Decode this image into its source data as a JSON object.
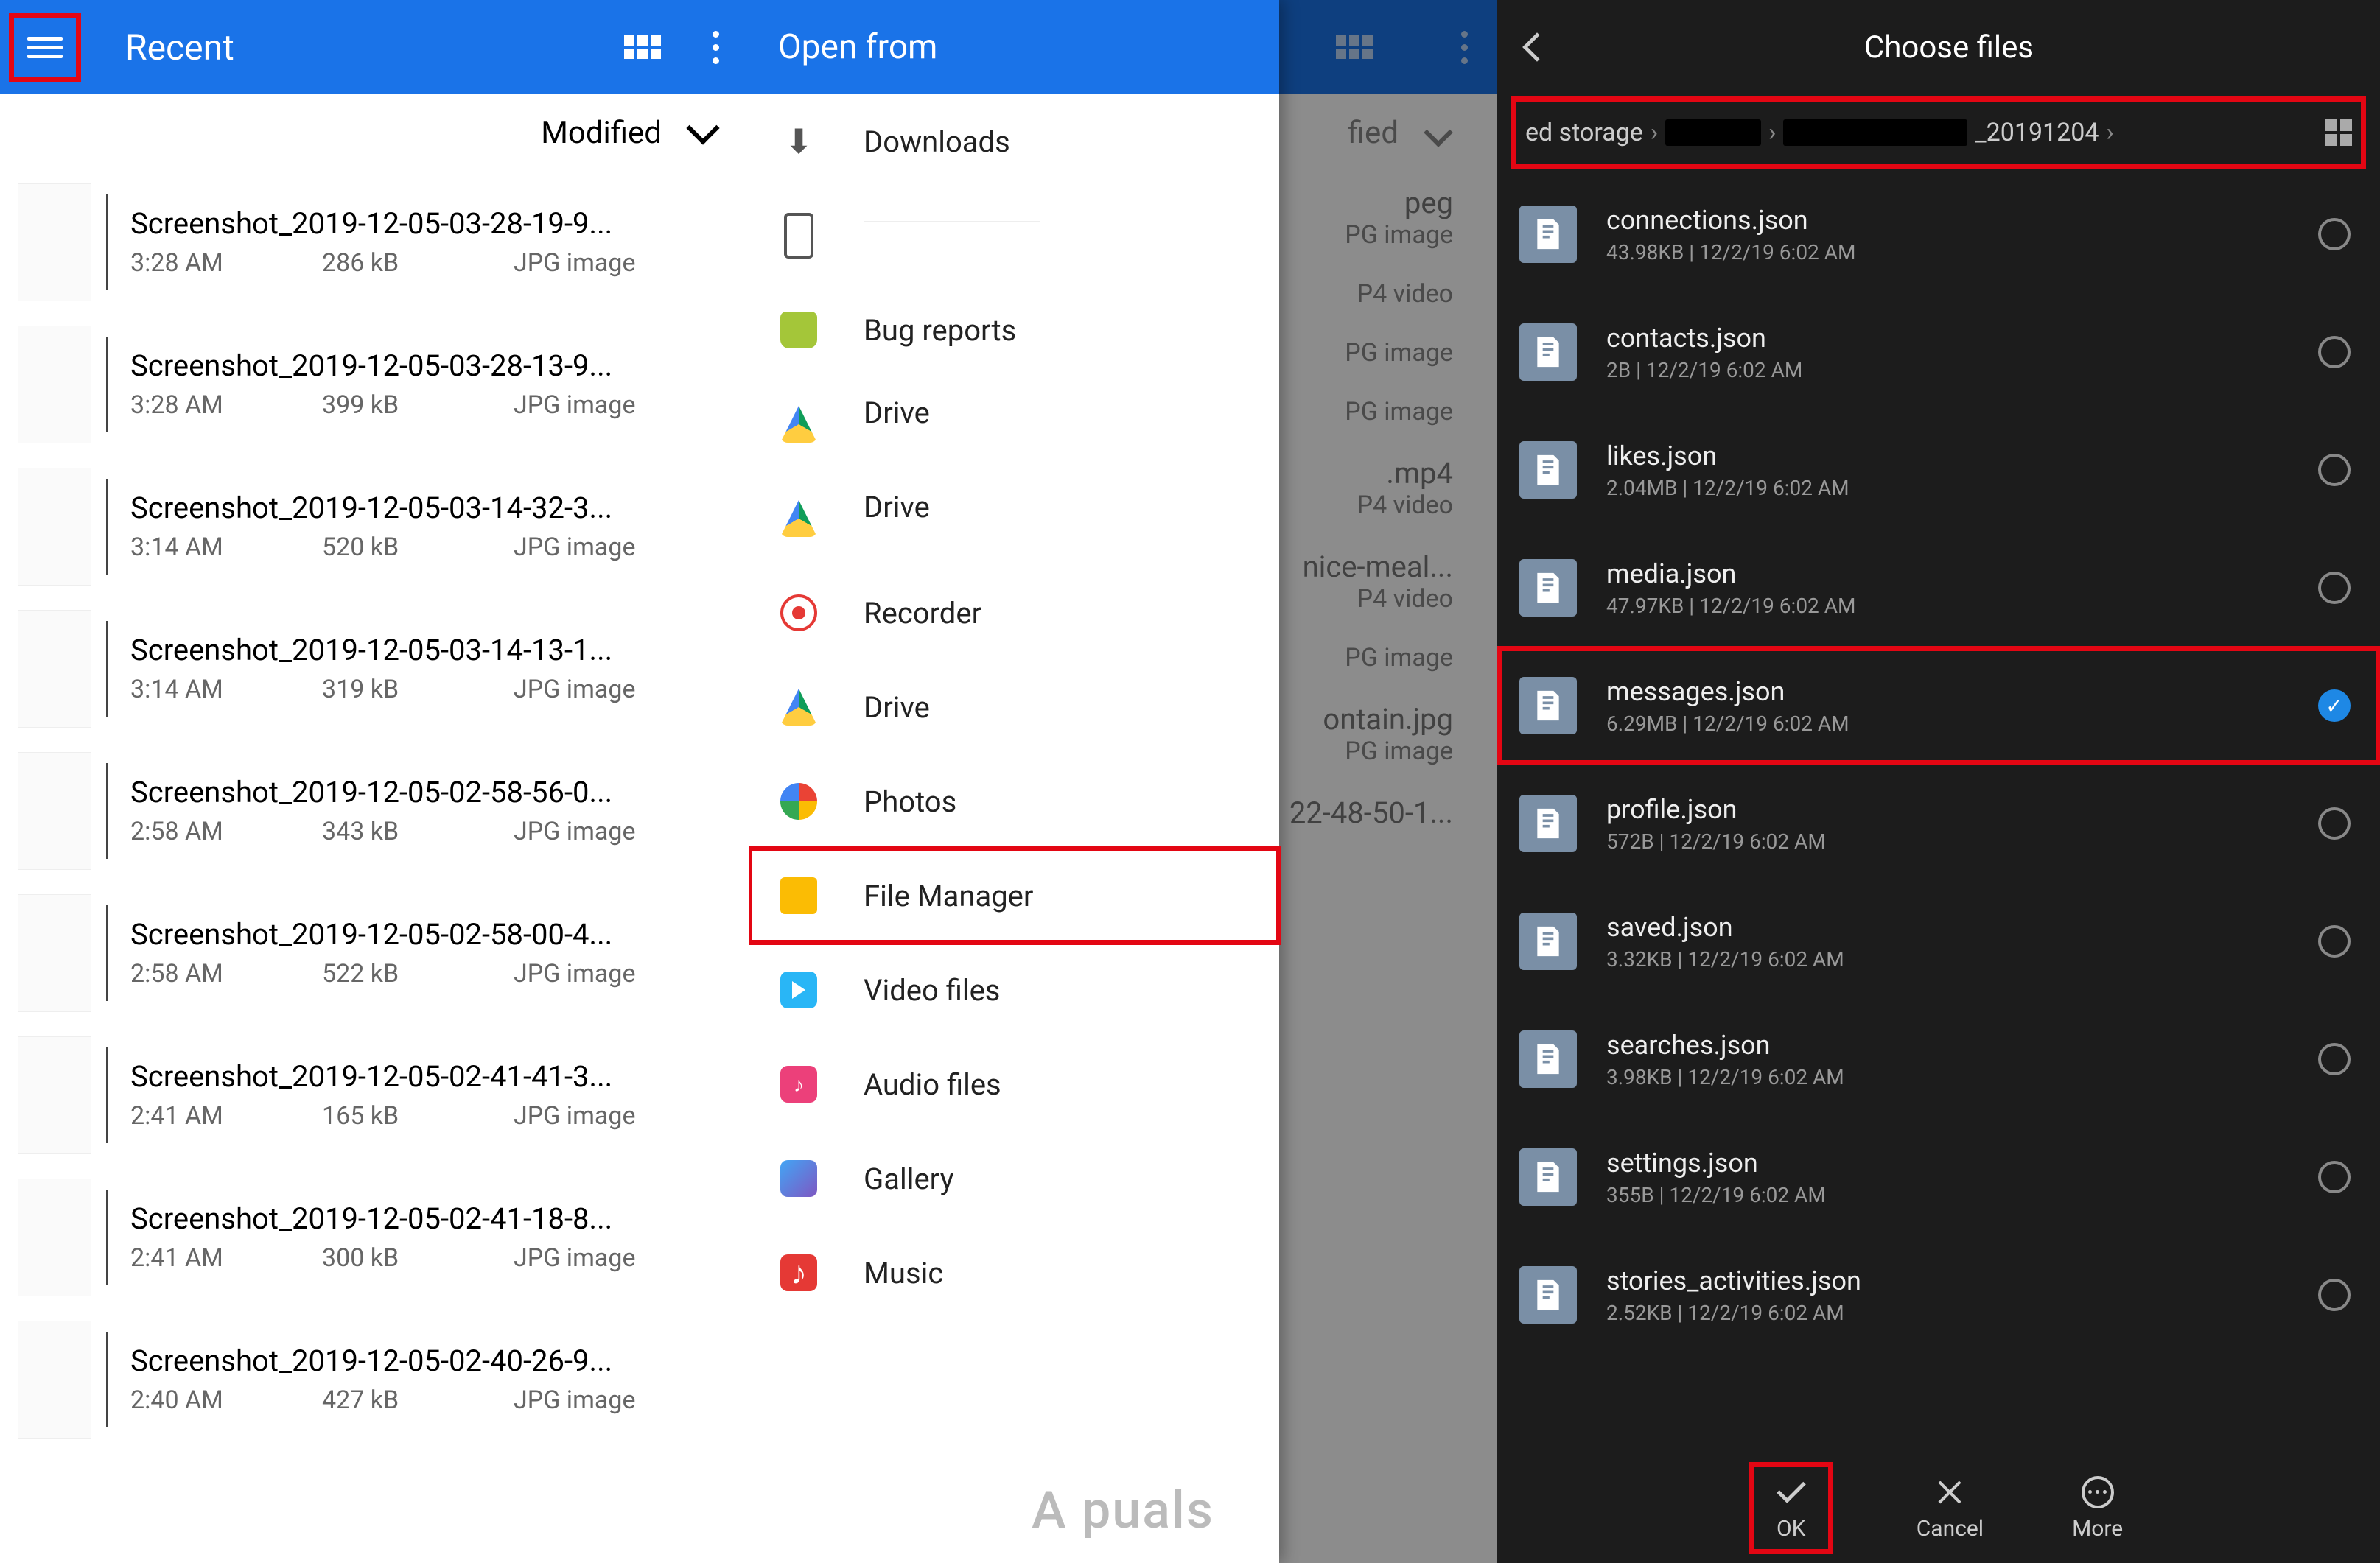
{
  "pane1": {
    "title": "Recent",
    "sort_label": "Modified",
    "files": [
      {
        "name": "Screenshot_2019-12-05-03-28-19-9...",
        "time": "3:28 AM",
        "size": "286 kB",
        "type": "JPG image"
      },
      {
        "name": "Screenshot_2019-12-05-03-28-13-9...",
        "time": "3:28 AM",
        "size": "399 kB",
        "type": "JPG image"
      },
      {
        "name": "Screenshot_2019-12-05-03-14-32-3...",
        "time": "3:14 AM",
        "size": "520 kB",
        "type": "JPG image"
      },
      {
        "name": "Screenshot_2019-12-05-03-14-13-1...",
        "time": "3:14 AM",
        "size": "319 kB",
        "type": "JPG image"
      },
      {
        "name": "Screenshot_2019-12-05-02-58-56-0...",
        "time": "2:58 AM",
        "size": "343 kB",
        "type": "JPG image"
      },
      {
        "name": "Screenshot_2019-12-05-02-58-00-4...",
        "time": "2:58 AM",
        "size": "522 kB",
        "type": "JPG image"
      },
      {
        "name": "Screenshot_2019-12-05-02-41-41-3...",
        "time": "2:41 AM",
        "size": "165 kB",
        "type": "JPG image"
      },
      {
        "name": "Screenshot_2019-12-05-02-41-18-8...",
        "time": "2:41 AM",
        "size": "300 kB",
        "type": "JPG image"
      },
      {
        "name": "Screenshot_2019-12-05-02-40-26-9...",
        "time": "2:40 AM",
        "size": "427 kB",
        "type": "JPG image"
      }
    ]
  },
  "pane2": {
    "drawer_title": "Open from",
    "dim_sort": "fied",
    "items": [
      {
        "label": "Downloads",
        "icon": "dl"
      },
      {
        "label": "",
        "icon": "phone",
        "redacted": true
      },
      {
        "label": "Bug reports",
        "icon": "android"
      },
      {
        "label": "Drive",
        "icon": "drive",
        "sub_redacted": true
      },
      {
        "label": "Drive",
        "icon": "drive",
        "sub_redacted": true
      },
      {
        "label": "Recorder",
        "icon": "rec"
      },
      {
        "label": "Drive",
        "icon": "drive"
      },
      {
        "label": "Photos",
        "icon": "photos"
      },
      {
        "label": "File Manager",
        "icon": "folder",
        "highlight": true
      },
      {
        "label": "Video files",
        "icon": "vid"
      },
      {
        "label": "Audio files",
        "icon": "aud"
      },
      {
        "label": "Gallery",
        "icon": "gal"
      },
      {
        "label": "Music",
        "icon": "mus"
      }
    ],
    "dim_files": [
      {
        "name": "peg",
        "type": "PG image"
      },
      {
        "name": "",
        "type": "P4 video"
      },
      {
        "name": "",
        "type": "PG image"
      },
      {
        "name": "",
        "type": "PG image"
      },
      {
        "name": ".mp4",
        "type": "P4 video"
      },
      {
        "name": "nice-meal...",
        "type": "P4 video"
      },
      {
        "name": "",
        "type": "PG image"
      },
      {
        "name": "ontain.jpg",
        "type": "PG image"
      },
      {
        "name": "22-48-50-1...",
        "type": ""
      }
    ]
  },
  "pane3": {
    "title": "Choose files",
    "crumb_prefix": "ed storage",
    "crumb_suffix": "_20191204",
    "files": [
      {
        "name": "connections.json",
        "meta": "43.98KB | 12/2/19 6:02 AM",
        "selected": false
      },
      {
        "name": "contacts.json",
        "meta": "2B | 12/2/19 6:02 AM",
        "selected": false
      },
      {
        "name": "likes.json",
        "meta": "2.04MB | 12/2/19 6:02 AM",
        "selected": false
      },
      {
        "name": "media.json",
        "meta": "47.97KB | 12/2/19 6:02 AM",
        "selected": false
      },
      {
        "name": "messages.json",
        "meta": "6.29MB | 12/2/19 6:02 AM",
        "selected": true,
        "highlight": true
      },
      {
        "name": "profile.json",
        "meta": "572B | 12/2/19 6:02 AM",
        "selected": false
      },
      {
        "name": "saved.json",
        "meta": "3.32KB | 12/2/19 6:02 AM",
        "selected": false
      },
      {
        "name": "searches.json",
        "meta": "3.98KB | 12/2/19 6:02 AM",
        "selected": false
      },
      {
        "name": "settings.json",
        "meta": "355B | 12/2/19 6:02 AM",
        "selected": false
      },
      {
        "name": "stories_activities.json",
        "meta": "2.52KB | 12/2/19 6:02 AM",
        "selected": false
      }
    ],
    "btn_ok": "OK",
    "btn_cancel": "Cancel",
    "btn_more": "More"
  },
  "watermark": "A    puals"
}
